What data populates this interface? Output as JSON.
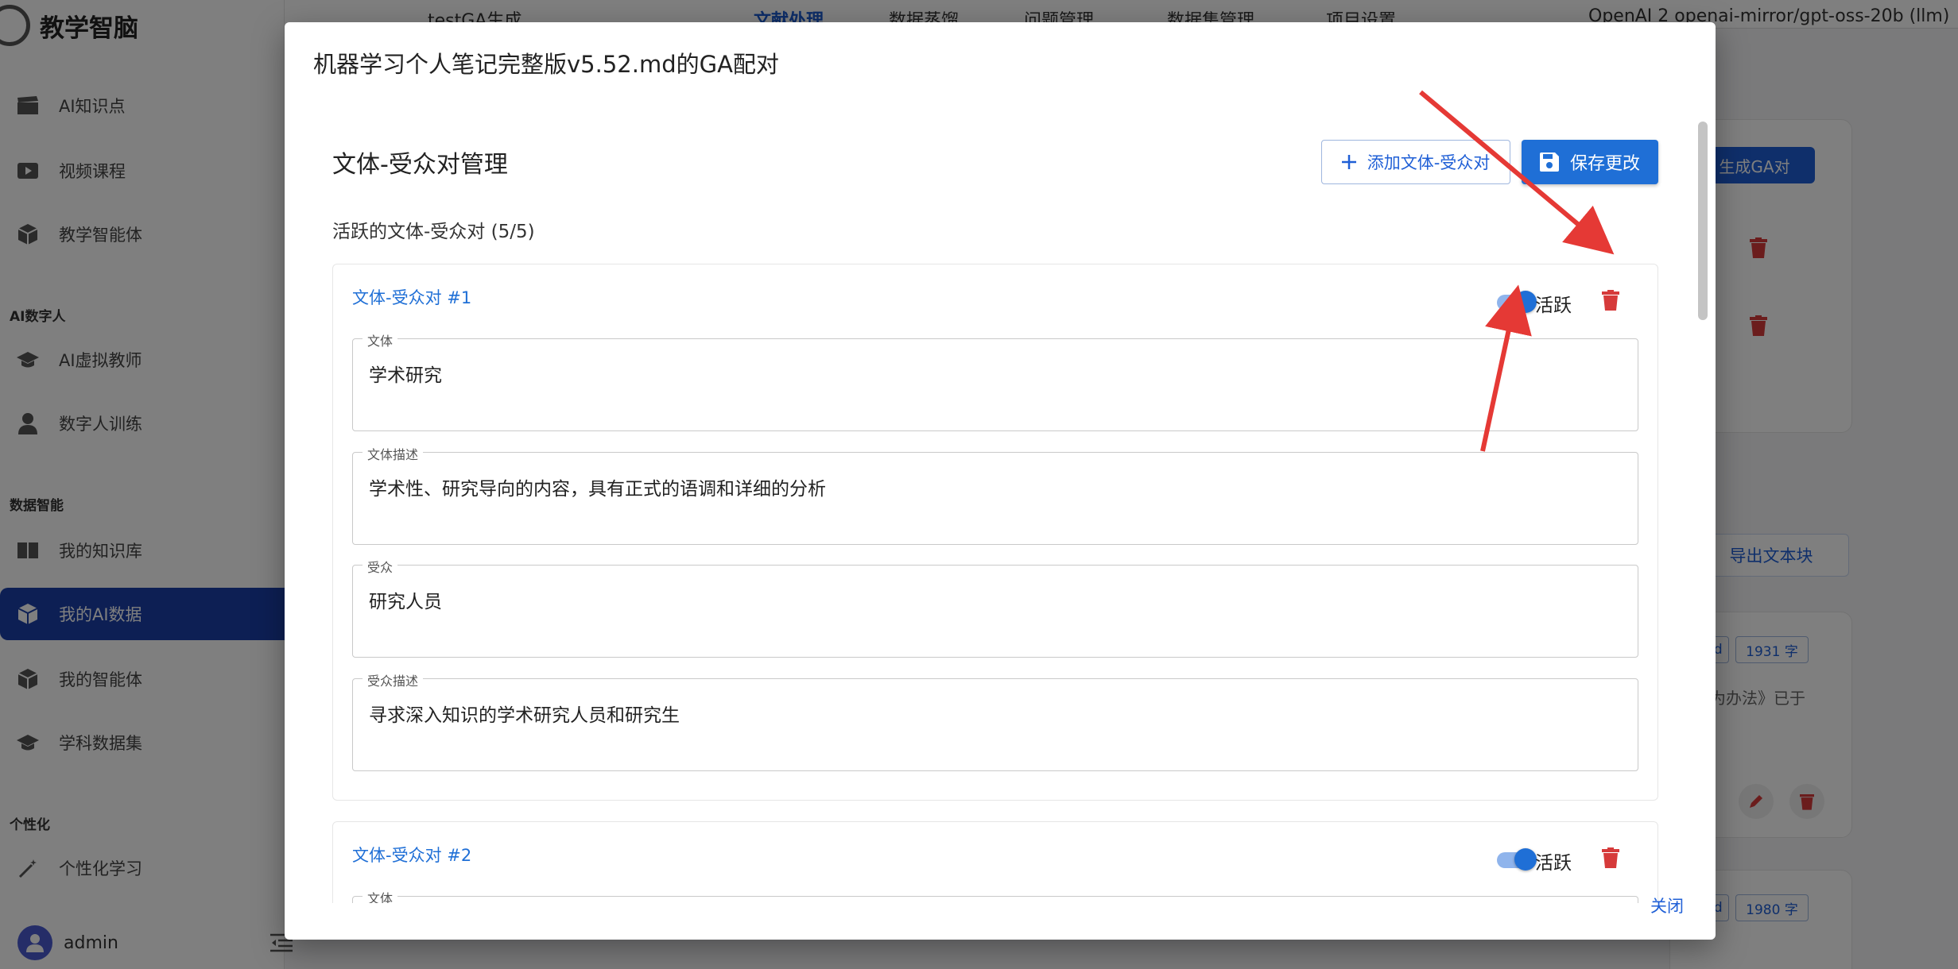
{
  "app": {
    "brand": "教学智脑",
    "nav": [
      {
        "label": "AI知识点",
        "icon": "clapper-icon"
      },
      {
        "label": "视频课程",
        "icon": "video-icon"
      },
      {
        "label": "教学智能体",
        "icon": "cube-icon"
      },
      {
        "label": "AI虚拟教师",
        "icon": "graduation-cap-icon"
      },
      {
        "label": "数字人训练",
        "icon": "person-icon"
      },
      {
        "label": "我的知识库",
        "icon": "book-icon"
      },
      {
        "label": "我的AI数据",
        "icon": "cube-icon",
        "active": true
      },
      {
        "label": "我的智能体",
        "icon": "cube-icon"
      },
      {
        "label": "学科数据集",
        "icon": "graduation-cap-icon"
      },
      {
        "label": "个性化学习",
        "icon": "magic-wand-icon"
      }
    ],
    "sections": {
      "ai_digital": "AI数字人",
      "data_intel": "数据智能",
      "personal": "个性化"
    },
    "user": "admin"
  },
  "topbar": {
    "project": "testGA生成",
    "tabs": [
      "文献处理",
      "数据蒸馏",
      "问题管理",
      "数据集管理",
      "项目设置"
    ],
    "model": "OpenAI 2 openai-mirror/gpt-oss-20b (llm)"
  },
  "background": {
    "generate_ga": "生成GA对",
    "export_blocks": "导出文本块",
    "chip_md": "md",
    "chip_count_1": "1931 字",
    "chip_count_2": "1980 字",
    "snippet": "行为办法》已于"
  },
  "dialog": {
    "title": "机器学习个人笔记完整版v5.52.md的GA配对",
    "section_title": "文体-受众对管理",
    "add_button": "添加文体-受众对",
    "save_button": "保存更改",
    "active_count": "活跃的文体-受众对 (5/5)",
    "close": "关闭",
    "pairs": [
      {
        "title": "文体-受众对 #1",
        "active_label": "活跃",
        "genre_label": "文体",
        "genre": "学术研究",
        "genre_desc_label": "文体描述",
        "genre_desc": "学术性、研究导向的内容，具有正式的语调和详细的分析",
        "audience_label": "受众",
        "audience": "研究人员",
        "audience_desc_label": "受众描述",
        "audience_desc": "寻求深入知识的学术研究人员和研究生"
      },
      {
        "title": "文体-受众对 #2",
        "active_label": "活跃",
        "genre_label": "文体"
      }
    ]
  },
  "colors": {
    "accent": "#1f6fd6",
    "danger": "#d63a3a",
    "annotation": "#e53935",
    "nav_active": "#1a3fa8"
  }
}
